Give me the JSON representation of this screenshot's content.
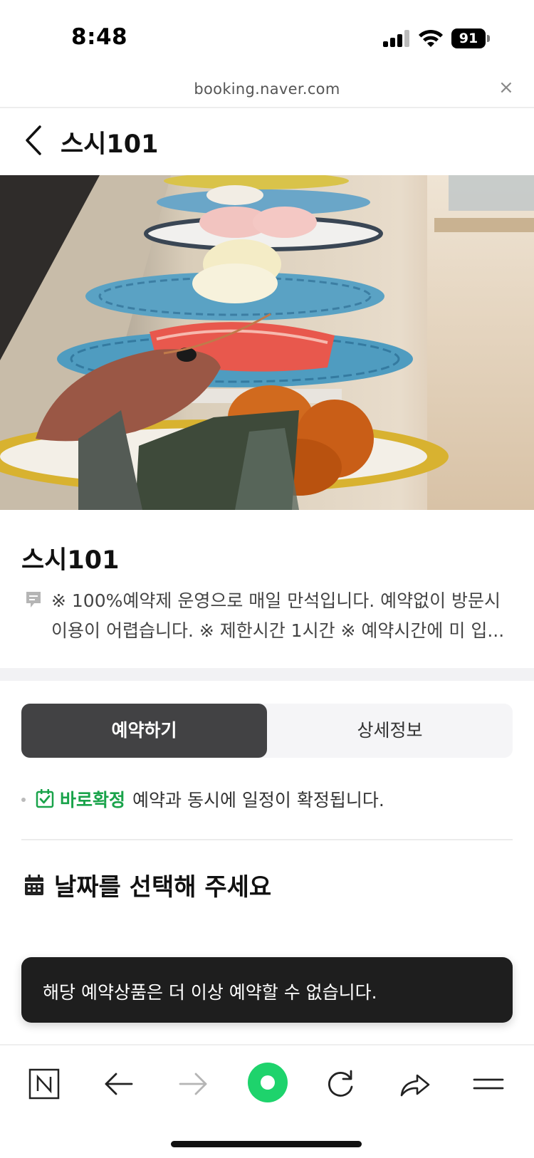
{
  "status_bar": {
    "time": "8:48",
    "battery": "91"
  },
  "browser": {
    "url": "booking.naver.com",
    "close_glyph": "×"
  },
  "header": {
    "title": "스시101",
    "back_icon": "chevron-left-icon"
  },
  "store": {
    "name": "스시101",
    "description_lines": [
      "※ 100%예약제 운영으로 매일 만석입니다. 예약없이 방문시",
      "이용이 어렵습니다. ※ 제한시간 1시간 ※ 예약시간에 미 입..."
    ]
  },
  "tabs": [
    {
      "label": "예약하기",
      "active": true
    },
    {
      "label": "상세정보",
      "active": false
    }
  ],
  "confirm": {
    "label": "바로확정",
    "text": "예약과 동시에 일정이 확정됩니다."
  },
  "date_section": {
    "title": "날짜를 선택해 주세요"
  },
  "toast": {
    "message": "해당 예약상품은 더 이상 예약할 수 없습니다."
  },
  "toolbar": {
    "icons": [
      "naver-home-icon",
      "back-arrow-icon",
      "forward-arrow-icon",
      "green-dot-icon",
      "refresh-icon",
      "share-icon",
      "menu-icon"
    ]
  },
  "colors": {
    "accent_green": "#19a34a",
    "tab_active": "#424244",
    "toast_bg": "#1e1e1e",
    "green_button": "#1ed36c"
  }
}
